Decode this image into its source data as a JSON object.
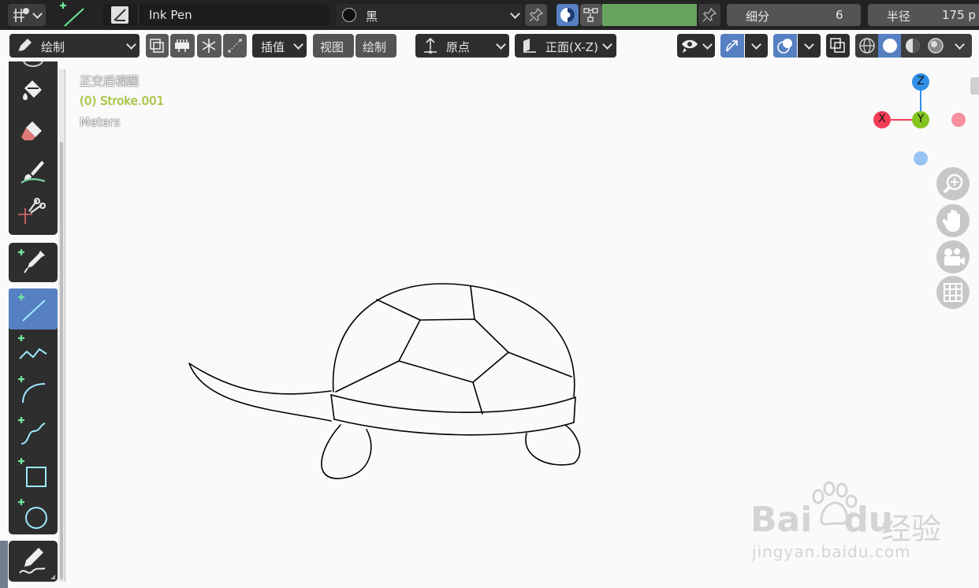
{
  "topbar": {
    "brush_name": "Ink Pen",
    "material_name": "黑",
    "subdivide_label": "细分",
    "subdivide_value": "6",
    "radius_label": "半径",
    "radius_value": "175 p"
  },
  "header": {
    "mode_label": "绘制",
    "interp_label": "插值",
    "view_label": "视图",
    "draw_label": "绘制",
    "pivot_label": "原点",
    "plane_label": "正面(X-Z)"
  },
  "viewport": {
    "view_name": "正交后视图",
    "object_label": "(0) Stroke.001",
    "units_label": "Meters",
    "object_color": "#a6c92f"
  },
  "gizmo": {
    "z_label": "Z",
    "x_label": "X",
    "y_label": "Y",
    "z_color": "#2f8fe8",
    "x_color": "#f23d57",
    "y_color": "#84c41e"
  },
  "watermark": {
    "brand": "Bai",
    "brand_suffix": "du",
    "site_cn": "经验",
    "url": "jingyan.baidu.com"
  }
}
